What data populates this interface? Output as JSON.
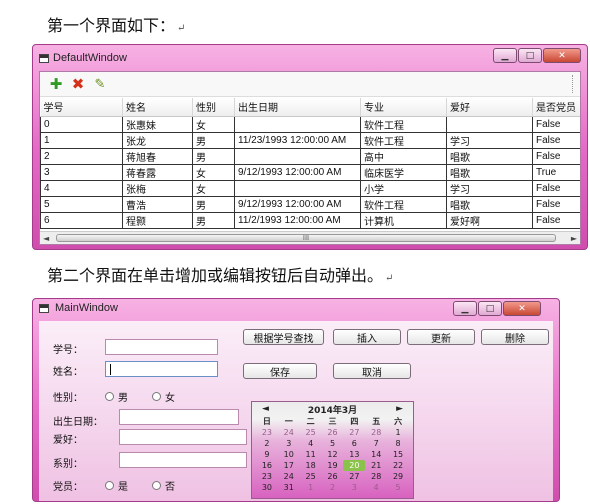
{
  "caption1": "第一个界面如下：",
  "caption2": "第二个界面在单击增加或编辑按钮后自动弹出。",
  "return_mark": "↵",
  "window1": {
    "title": "DefaultWindow",
    "columns": [
      "学号",
      "姓名",
      "性别",
      "出生日期",
      "专业",
      "爱好",
      "是否党员"
    ],
    "rows": [
      [
        "0",
        "张惠妹",
        "女",
        "",
        "软件工程",
        "",
        "False"
      ],
      [
        "1",
        "张龙",
        "男",
        "11/23/1993 12:00:00 AM",
        "软件工程",
        "学习",
        "False"
      ],
      [
        "2",
        "蒋旭春",
        "男",
        "",
        "高中",
        "唱歌",
        "False"
      ],
      [
        "3",
        "蒋春露",
        "女",
        "9/12/1993 12:00:00 AM",
        "临床医学",
        "唱歌",
        "True"
      ],
      [
        "4",
        "张梅",
        "女",
        "",
        "小学",
        "学习",
        "False"
      ],
      [
        "5",
        "曹浩",
        "男",
        "9/12/1993 12:00:00 AM",
        "软件工程",
        "唱歌",
        "False"
      ],
      [
        "6",
        "程颢",
        "男",
        "11/2/1993 12:00:00 AM",
        "计算机",
        "爱好啊",
        "False"
      ]
    ],
    "scroll_thumb": "III"
  },
  "window2": {
    "title": "MainWindow",
    "labels": {
      "id": "学号：",
      "name": "姓名：",
      "gender": "性别：",
      "birth": "出生日期：",
      "hobby": "爱好：",
      "dept": "系别：",
      "party": "党员："
    },
    "gender_options": [
      "男",
      "女"
    ],
    "party_options": [
      "是",
      "否"
    ],
    "buttons": {
      "search": "根据学号查找",
      "insert": "插入",
      "update": "更新",
      "delete": "删除",
      "save": "保存",
      "cancel": "取消"
    },
    "calendar": {
      "month_label": "2014年3月",
      "prev": "◄",
      "next": "►",
      "weekdays": [
        "日",
        "一",
        "二",
        "三",
        "四",
        "五",
        "六"
      ],
      "days": [
        [
          "23",
          "24",
          "25",
          "26",
          "27",
          "28",
          "1"
        ],
        [
          "2",
          "3",
          "4",
          "5",
          "6",
          "7",
          "8"
        ],
        [
          "9",
          "10",
          "11",
          "12",
          "13",
          "14",
          "15"
        ],
        [
          "16",
          "17",
          "18",
          "19",
          "20",
          "21",
          "22"
        ],
        [
          "23",
          "24",
          "25",
          "26",
          "27",
          "28",
          "29"
        ],
        [
          "30",
          "31",
          "1",
          "2",
          "3",
          "4",
          "5"
        ]
      ],
      "selected": "20"
    }
  }
}
